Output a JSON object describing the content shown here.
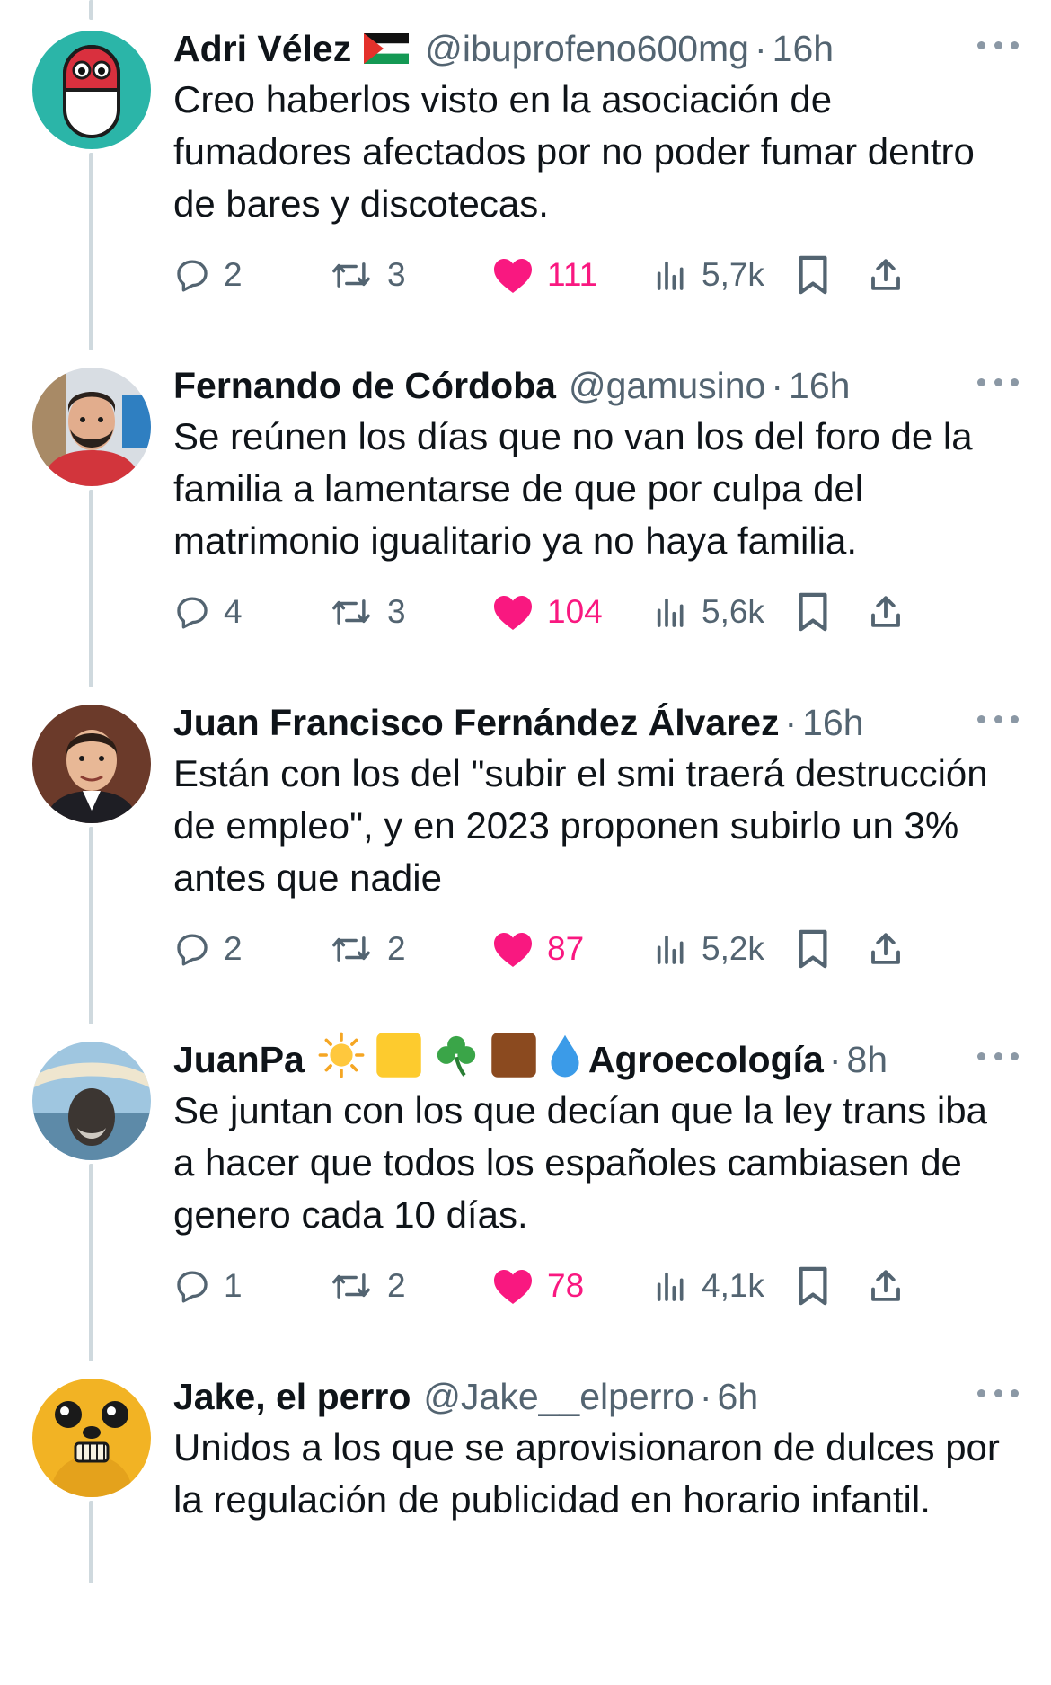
{
  "tweets": [
    {
      "name": "Adri Vélez",
      "handle": "@ibuprofeno600mg",
      "time": "16h",
      "text": "Creo haberlos visto en la asociación de fumadores afectados por no poder fumar dentro de bares y discotecas.",
      "replies": "2",
      "retweets": "3",
      "likes": "111",
      "views": "5,7k"
    },
    {
      "name": "Fernando de Córdoba",
      "handle": "@gamusino",
      "time": "16h",
      "text": "Se reúnen los días que no van los del foro de la familia a lamentarse de que por culpa del matrimonio igualitario ya no haya familia.",
      "replies": "4",
      "retweets": "3",
      "likes": "104",
      "views": "5,6k"
    },
    {
      "name": "Juan Francisco Fernández Álvarez",
      "time": "16h",
      "text": "Están con los del \"subir el smi traerá destrucción de empleo\", y en 2023 proponen subirlo un 3% antes que nadie",
      "replies": "2",
      "retweets": "2",
      "likes": "87",
      "views": "5,2k"
    },
    {
      "name": "JuanPa",
      "name2": "Agroecología",
      "time": "8h",
      "text": "Se juntan con los que decían que la ley trans iba a hacer que todos los españoles cambiasen de genero cada 10 días.",
      "replies": "1",
      "retweets": "2",
      "likes": "78",
      "views": "4,1k"
    },
    {
      "name": "Jake, el perro",
      "handle": "@Jake__elperro",
      "time": "6h",
      "text": "Unidos a los que se aprovisionaron de dulces por la regulación de publicidad en horario infantil."
    }
  ],
  "separator": "·",
  "colors": {
    "like": "#f91880",
    "muted": "#536471",
    "thread_line": "#cfd9de"
  }
}
